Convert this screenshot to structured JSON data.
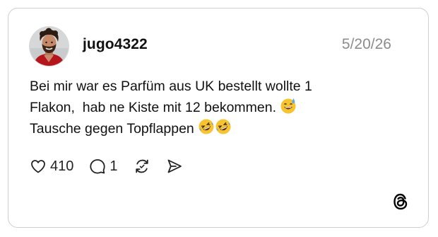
{
  "post": {
    "username": "jugo4322",
    "date": "5/20/26",
    "lines": [
      "Bei mir war es Parfüm aus UK bestellt wollte 1",
      "Flakon,  hab ne Kiste mit 12 bekommen.",
      "Tausche gegen Topflappen"
    ],
    "emojis": {
      "line2": "grinning-face-with-sweat",
      "line3": [
        "rolling-on-the-floor-laughing",
        "rolling-on-the-floor-laughing"
      ]
    }
  },
  "actions": {
    "likes": "410",
    "replies": "1",
    "like_icon": "heart-icon",
    "reply_icon": "comment-icon",
    "repost_icon": "repost-icon",
    "share_icon": "send-icon"
  },
  "brand": {
    "logo": "threads-logo-icon"
  },
  "colors": {
    "border": "#cfcfcf",
    "text": "#111111",
    "muted": "#8c8c8c",
    "emoji_yellow": "#f7c430"
  }
}
